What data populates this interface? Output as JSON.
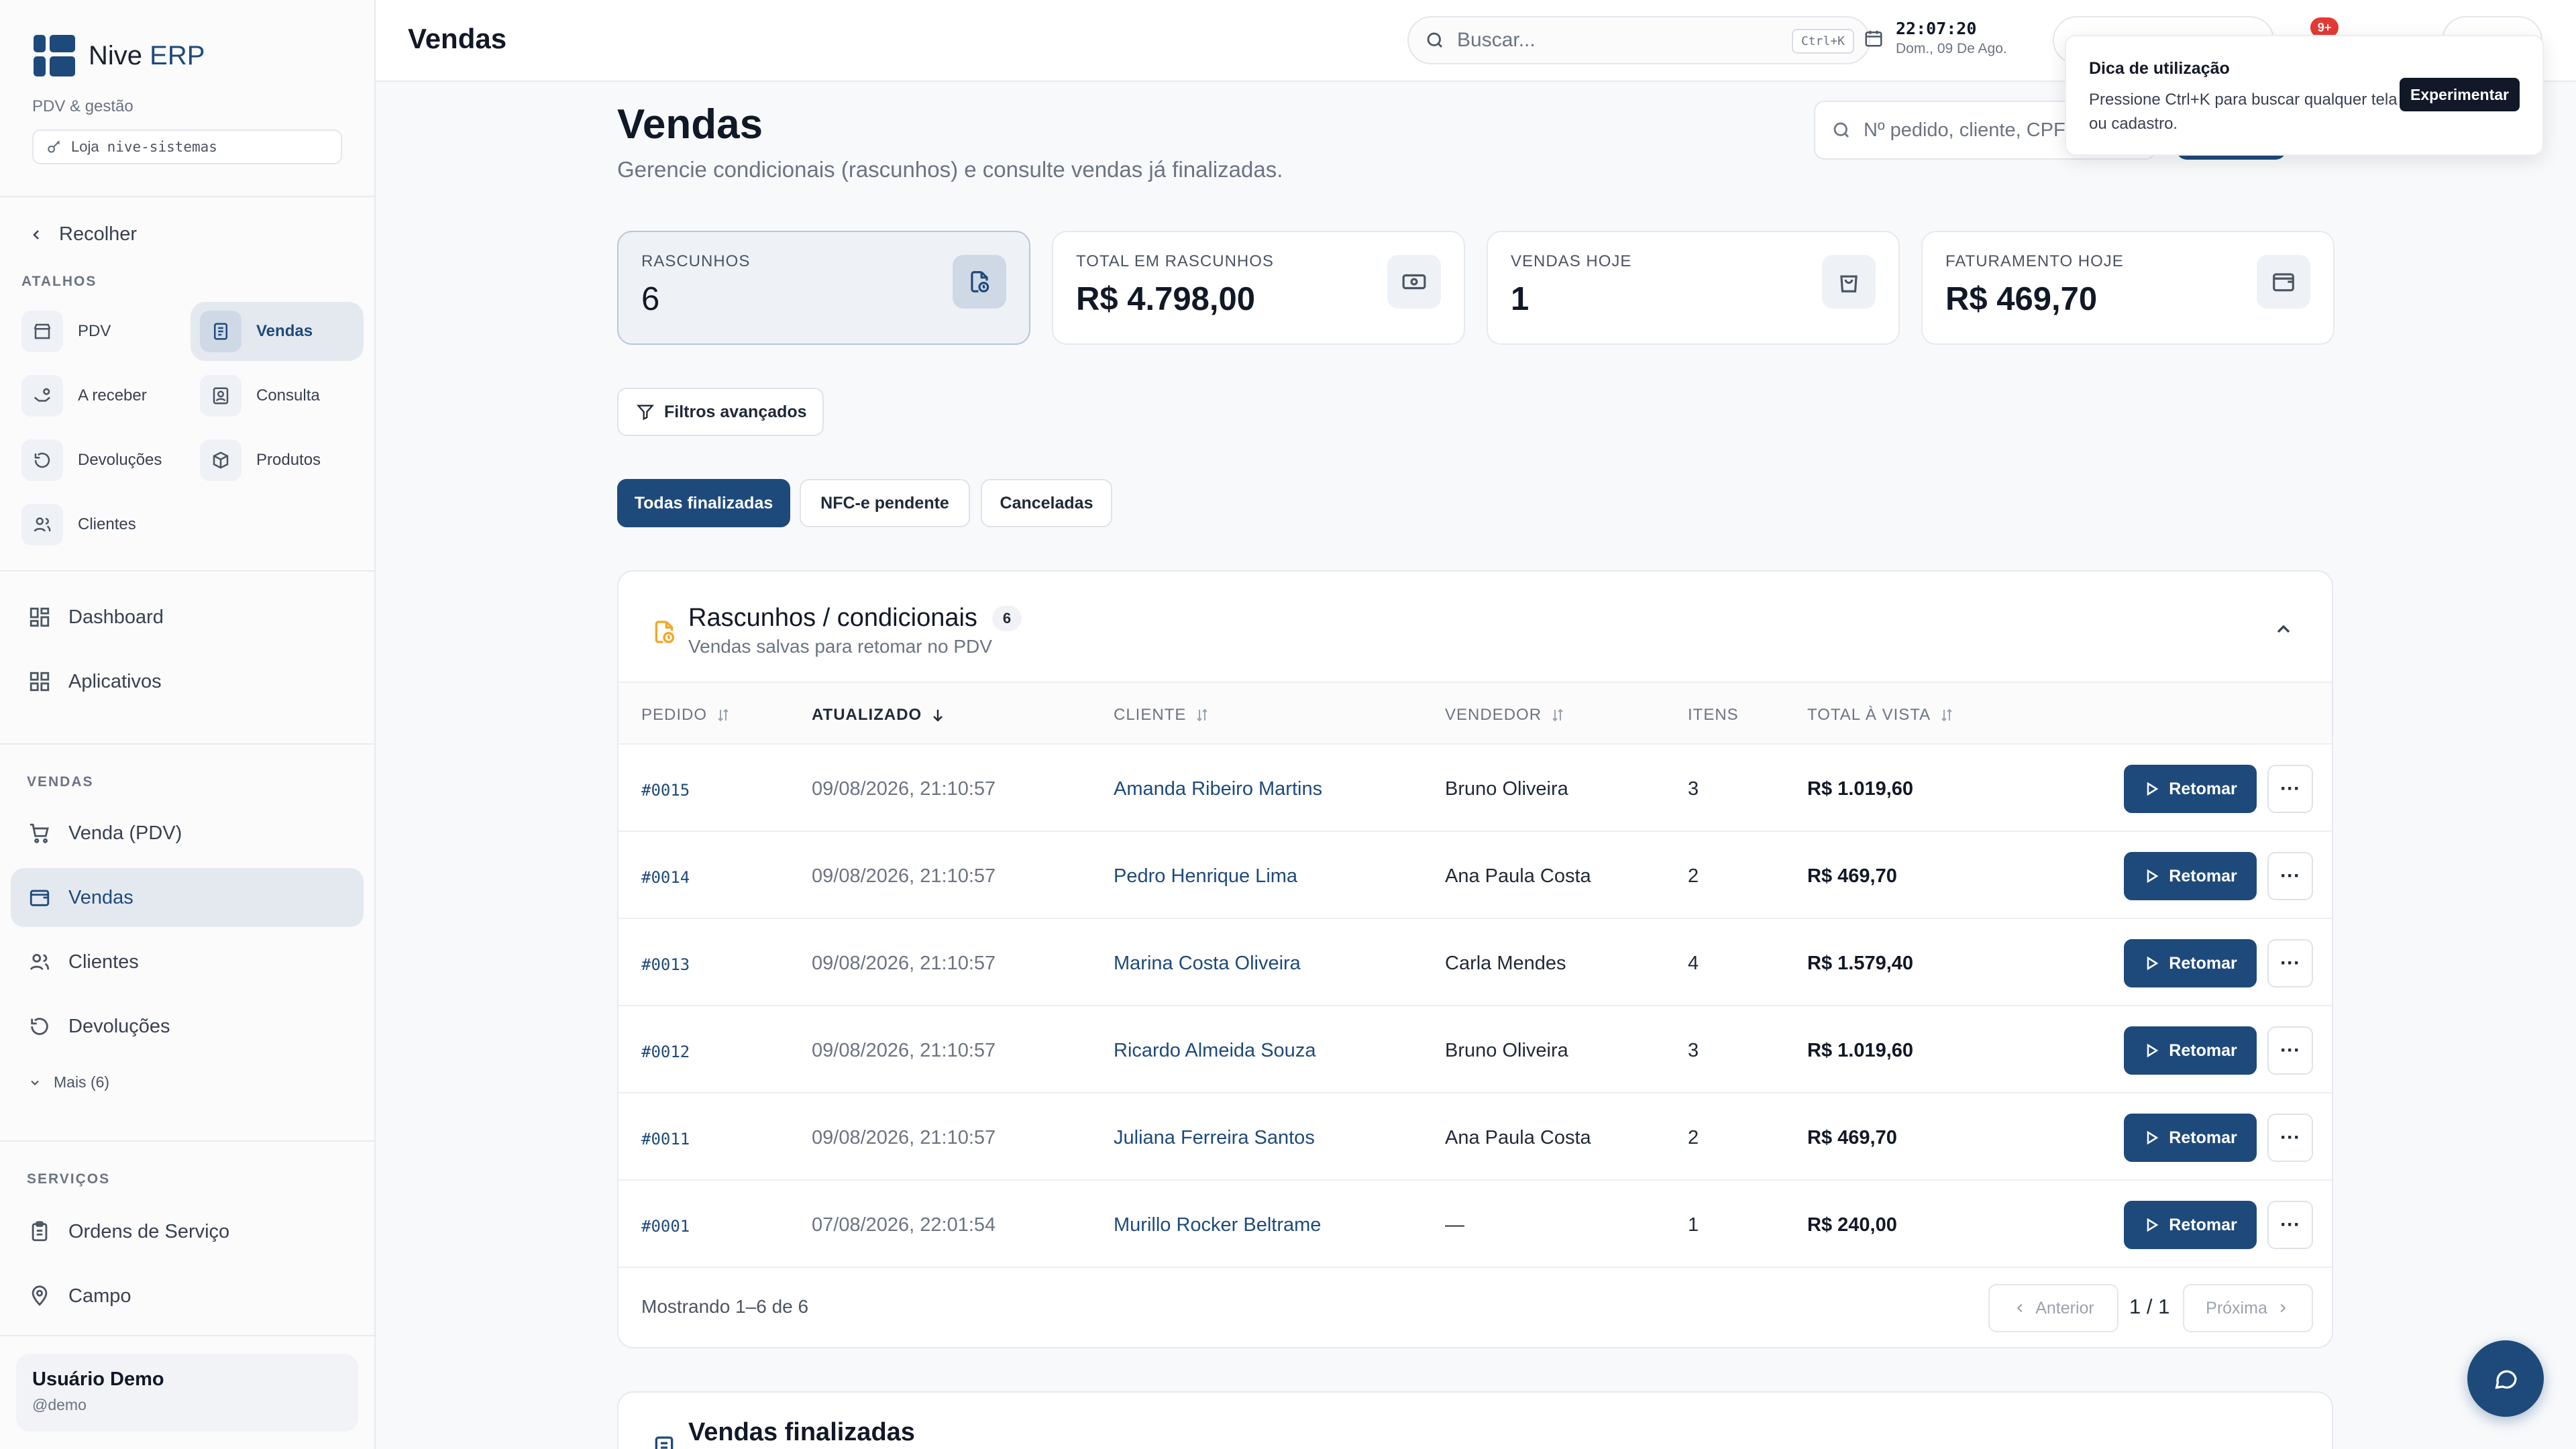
{
  "brand": {
    "name_prefix": "Nive",
    "name_suffix": "ERP",
    "subtitle": "PDV & gestão",
    "store_label": "Loja",
    "store_slug": "nive-sistemas"
  },
  "sidebar": {
    "collapse_label": "Recolher",
    "shortcuts_label": "ATALHOS",
    "shortcuts": [
      {
        "label": "PDV",
        "icon": "store-icon"
      },
      {
        "label": "Vendas",
        "icon": "receipt-icon",
        "active": true
      },
      {
        "label": "A receber",
        "icon": "hand-coins-icon"
      },
      {
        "label": "Consulta",
        "icon": "contact-icon"
      },
      {
        "label": "Devoluções",
        "icon": "undo-icon"
      },
      {
        "label": "Produtos",
        "icon": "box-icon"
      },
      {
        "label": "Clientes",
        "icon": "users-icon"
      }
    ],
    "main_items": [
      {
        "label": "Dashboard",
        "icon": "grid-icon"
      },
      {
        "label": "Aplicativos",
        "icon": "apps-icon"
      }
    ],
    "sales_label": "VENDAS",
    "sales_items": [
      {
        "label": "Venda (PDV)",
        "icon": "cart-icon"
      },
      {
        "label": "Vendas",
        "icon": "wallet-icon",
        "active": true
      },
      {
        "label": "Clientes",
        "icon": "users-icon"
      },
      {
        "label": "Devoluções",
        "icon": "undo-icon"
      }
    ],
    "more_label": "Mais (6)",
    "services_label": "SERVIÇOS",
    "services_items": [
      {
        "label": "Ordens de Serviço",
        "icon": "clipboard-icon"
      },
      {
        "label": "Campo",
        "icon": "map-pin-icon"
      }
    ],
    "user": {
      "name": "Usuário Demo",
      "handle": "@demo"
    }
  },
  "topbar": {
    "title": "Vendas",
    "search_placeholder": "Buscar...",
    "search_shortcut": "Ctrl+K",
    "time": "22:07:20",
    "date": "Dom., 09 De Ago.",
    "notification_count": "9+"
  },
  "tooltip": {
    "title": "Dica de utilização",
    "body": "Pressione Ctrl+K para buscar qualquer tela ou cadastro.",
    "button": "Experimentar"
  },
  "page": {
    "title": "Vendas",
    "subtitle": "Gerencie condicionais (rascunhos) e consulte vendas já finalizadas.",
    "search_placeholder": "Nº pedido, cliente, CPF..."
  },
  "stats": [
    {
      "label": "RASCUNHOS",
      "value": "6",
      "icon": "draft-icon",
      "active": true
    },
    {
      "label": "TOTAL EM RASCUNHOS",
      "value": "R$ 4.798,00",
      "icon": "banknote-icon"
    },
    {
      "label": "VENDAS HOJE",
      "value": "1",
      "icon": "bag-icon"
    },
    {
      "label": "FATURAMENTO HOJE",
      "value": "R$ 469,70",
      "icon": "wallet-icon"
    }
  ],
  "filters_label": "Filtros avançados",
  "tabs": [
    {
      "label": "Todas finalizadas",
      "active": true
    },
    {
      "label": "NFC-e pendente"
    },
    {
      "label": "Canceladas"
    }
  ],
  "drafts": {
    "title": "Rascunhos / condicionais",
    "count": "6",
    "subtitle": "Vendas salvas para retomar no PDV",
    "columns": [
      "PEDIDO",
      "ATUALIZADO",
      "CLIENTE",
      "VENDEDOR",
      "ITENS",
      "TOTAL À VISTA"
    ],
    "rows": [
      {
        "order": "#0015",
        "updated": "09/08/2026, 21:10:57",
        "client": "Amanda Ribeiro Martins",
        "seller": "Bruno Oliveira",
        "items": "3",
        "total": "R$ 1.019,60"
      },
      {
        "order": "#0014",
        "updated": "09/08/2026, 21:10:57",
        "client": "Pedro Henrique Lima",
        "seller": "Ana Paula Costa",
        "items": "2",
        "total": "R$ 469,70"
      },
      {
        "order": "#0013",
        "updated": "09/08/2026, 21:10:57",
        "client": "Marina Costa Oliveira",
        "seller": "Carla Mendes",
        "items": "4",
        "total": "R$ 1.579,40"
      },
      {
        "order": "#0012",
        "updated": "09/08/2026, 21:10:57",
        "client": "Ricardo Almeida Souza",
        "seller": "Bruno Oliveira",
        "items": "3",
        "total": "R$ 1.019,60"
      },
      {
        "order": "#0011",
        "updated": "09/08/2026, 21:10:57",
        "client": "Juliana Ferreira Santos",
        "seller": "Ana Paula Costa",
        "items": "2",
        "total": "R$ 469,70"
      },
      {
        "order": "#0001",
        "updated": "07/08/2026, 22:01:54",
        "client": "Murillo Rocker Beltrame",
        "seller": "—",
        "items": "1",
        "total": "R$ 240,00"
      }
    ],
    "resume_label": "Retomar",
    "more_label": "···",
    "footer_text": "Mostrando 1–6 de 6",
    "prev_label": "Anterior",
    "next_label": "Próxima",
    "page_indicator": "1 / 1"
  },
  "finalized": {
    "title": "Vendas finalizadas"
  },
  "colors": {
    "primary": "#1e4a7b",
    "accent_orange": "#f5a524",
    "badge_red": "#e53935"
  }
}
